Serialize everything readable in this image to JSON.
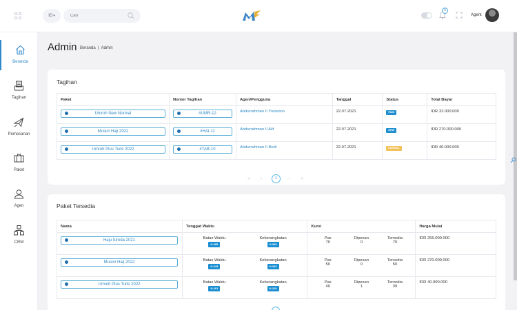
{
  "header": {
    "language": "ID",
    "language_arrow": "▾",
    "search_placeholder": "Cari",
    "notification_count": "8",
    "agent_label": "Agent"
  },
  "sidebar": [
    {
      "label": "Beranda",
      "icon": "home-icon",
      "active": true
    },
    {
      "label": "Tagihan",
      "icon": "invoice-icon",
      "active": false
    },
    {
      "label": "Pemesanan",
      "icon": "plane-icon",
      "active": false
    },
    {
      "label": "Paket",
      "icon": "package-icon",
      "active": false
    },
    {
      "label": "Agen",
      "icon": "agent-icon",
      "active": false
    },
    {
      "label": "CRM",
      "icon": "crm-icon",
      "active": false
    }
  ],
  "page": {
    "title": "Admin",
    "breadcrumb": "Beranda  |  Admin"
  },
  "tagihan": {
    "title": "Tagihan",
    "columns": [
      "Paket",
      "Nomor Tagihan",
      "Agen/Pengguna",
      "Tanggal",
      "Status",
      "Total Bayar"
    ],
    "rows": [
      {
        "paket": "Umroh New Normal",
        "nomor": "#UMR-12",
        "agen": "Abdurrahman II Yuswono",
        "tanggal": "22.07.2021",
        "status": "PAID",
        "status_color": "#1f8fd0",
        "total": "IDR 32.000.000"
      },
      {
        "paket": "Musim Haji 2022",
        "nomor": "#HAI-11",
        "agen": "Abdurrahman II Alif",
        "tanggal": "22.07.2021",
        "status": "NEW",
        "status_color": "#1f8fd0",
        "total": "IDR 270.000.000"
      },
      {
        "paket": "Umroh Plus Turki 2022",
        "nomor": "#TAB-10",
        "agen": "Abdurrahman II Budi",
        "tanggal": "22.07.2021",
        "status": "PARTIAL",
        "status_color": "#f3c25a",
        "total": "IDR 40.000.000"
      }
    ],
    "pagination": {
      "current": "1"
    }
  },
  "paket_tersedia": {
    "title": "Paket Tersedia",
    "columns": [
      "Nama",
      "Tenggat Waktu",
      "Kursi",
      "Harga Mulai"
    ],
    "sub_labels": {
      "batas": "Batas Waktu",
      "keberangkatan": "Keberangkatan",
      "pax": "Pax",
      "dipesan": "Dipesan",
      "tersedia": "Tersedia"
    },
    "rows": [
      {
        "nama": "Haju furoda 2021",
        "batas": "H-385",
        "keberangkatan": "H-393",
        "pax": "70",
        "dipesan": "0",
        "tersedia": "70",
        "harga": "IDR 255.000.000"
      },
      {
        "nama": "Musim Haji 2022",
        "batas": "H-343",
        "keberangkatan": "H-343",
        "pax": "50",
        "dipesan": "0",
        "tersedia": "50",
        "harga": "IDR 270.000.000"
      },
      {
        "nama": "Umroh Plus Turki 2022",
        "batas": "H-201",
        "keberangkatan": "H-229",
        "pax": "40",
        "dipesan": "1",
        "tersedia": "39",
        "harga": "IDR 40.000.000"
      }
    ]
  }
}
